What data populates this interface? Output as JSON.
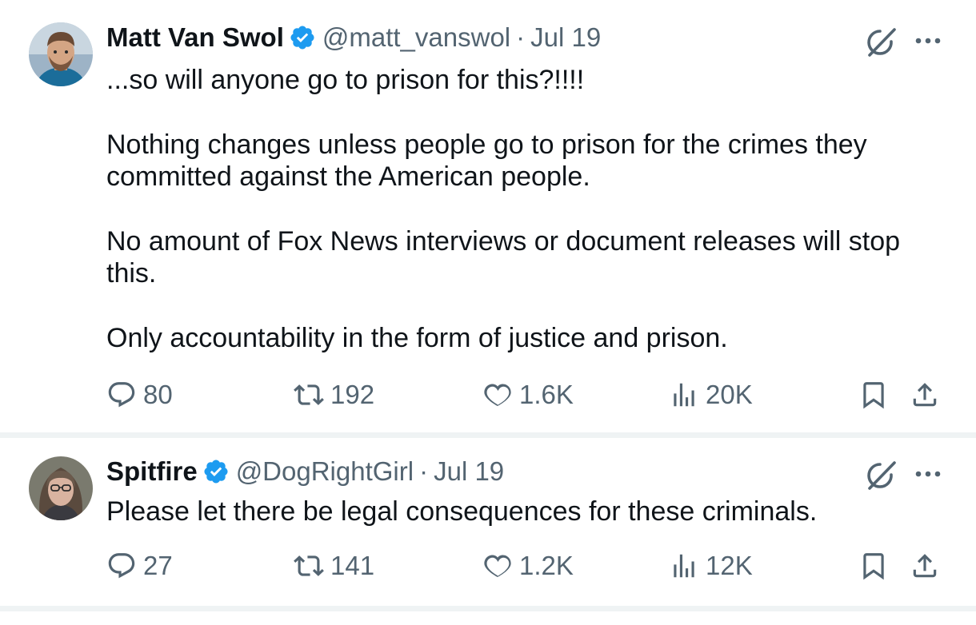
{
  "tweets": [
    {
      "name": "Matt Van Swol",
      "handle": "@matt_vanswol",
      "separator": "·",
      "date": "Jul 19",
      "paragraphs": [
        "...so will anyone go to prison for this?!!!!",
        "Nothing changes unless people go to prison for the crimes they committed against the American people.",
        "No amount of Fox News interviews or document releases will stop this.",
        "Only accountability in the form of justice and prison."
      ],
      "replies": "80",
      "reposts": "192",
      "likes": "1.6K",
      "views": "20K"
    },
    {
      "name": "Spitfire",
      "handle": "@DogRightGirl",
      "separator": "·",
      "date": "Jul 19",
      "paragraphs": [
        "Please let there be legal consequences for these criminals."
      ],
      "replies": "27",
      "reposts": "141",
      "likes": "1.2K",
      "views": "12K"
    }
  ],
  "icons": {
    "verified": "verified-badge-icon",
    "grok": "grok-icon",
    "more": "more-icon",
    "reply": "reply-icon",
    "repost": "repost-icon",
    "like": "heart-icon",
    "views": "views-icon",
    "bookmark": "bookmark-icon",
    "share": "share-icon"
  },
  "colors": {
    "text": "#0f1419",
    "secondary": "#536471",
    "verified": "#1d9bf0",
    "divider": "#eff3f4"
  }
}
